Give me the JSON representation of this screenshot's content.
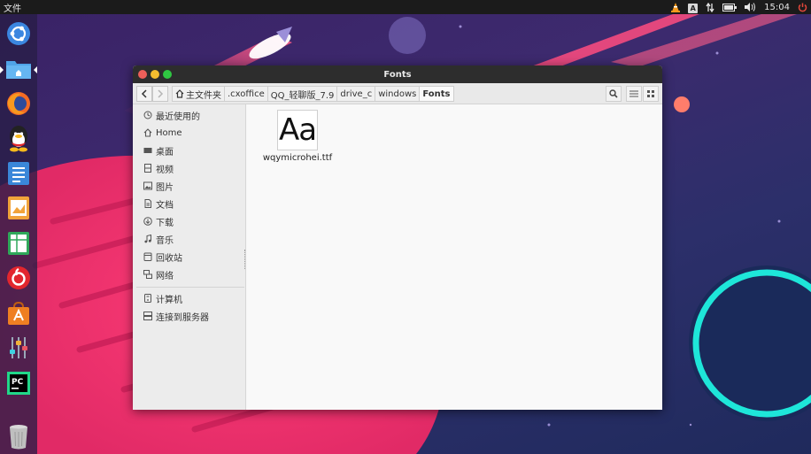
{
  "top_panel": {
    "app_menu": "文件",
    "clock": "15:04",
    "tray_icons": [
      "vlc-icon",
      "keyboard-icon",
      "network-icon",
      "battery-icon",
      "volume-icon",
      "power-icon"
    ],
    "keyboard_label": "A"
  },
  "launcher": {
    "items": [
      {
        "name": "ubuntu-logo-icon",
        "active": false
      },
      {
        "name": "file-manager-icon",
        "active": true
      },
      {
        "name": "firefox-icon",
        "active": false
      },
      {
        "name": "qq-icon",
        "active": false
      },
      {
        "name": "writer-icon",
        "active": false
      },
      {
        "name": "impress-icon",
        "active": false
      },
      {
        "name": "calc-icon",
        "active": false
      },
      {
        "name": "netease-music-icon",
        "active": false
      },
      {
        "name": "software-center-icon",
        "active": false
      },
      {
        "name": "settings-icon",
        "active": false
      },
      {
        "name": "pycharm-icon",
        "active": false
      },
      {
        "name": "trash-icon",
        "active": false
      }
    ],
    "pycharm_label": "PC"
  },
  "window": {
    "title": "Fonts",
    "breadcrumbs": [
      "主文件夹",
      ".cxoffice",
      "QQ_轻聊版_7.9",
      "drive_c",
      "windows",
      "Fonts"
    ],
    "sidebar": {
      "places": [
        "最近使用的",
        "Home",
        "桌面",
        "视频",
        "图片",
        "文档",
        "下载",
        "音乐",
        "回收站",
        "网络"
      ],
      "devices": [
        "计算机",
        "连接到服务器"
      ]
    },
    "files": [
      {
        "name": "wqymicrohei.ttf",
        "preview": "Aa"
      }
    ]
  },
  "colors": {
    "panel": "#1b1b1b",
    "close": "#ed5f5a",
    "minimize": "#f5bd2f",
    "maximize": "#2fc742",
    "wallpaper_pink": "#f0336e",
    "wallpaper_cyan": "#1ee6d9"
  }
}
